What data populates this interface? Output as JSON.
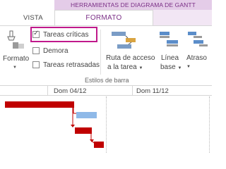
{
  "ribbon": {
    "context_header": "HERRAMIENTAS DE DIAGRAMA DE GANTT",
    "tabs": [
      {
        "label": "VISTA"
      },
      {
        "label": "FORMATO"
      }
    ]
  },
  "format_button": {
    "label": "Formato",
    "icon": "paintbrush-icon"
  },
  "checkboxes": [
    {
      "label": "Tareas críticas",
      "checked": true
    },
    {
      "label": "Demora",
      "checked": false
    },
    {
      "label": "Tareas retrasadas",
      "checked": false
    }
  ],
  "ruta_button": {
    "line1": "Ruta de acceso",
    "line2": "a la tarea",
    "icon": "path-icon"
  },
  "linea_button": {
    "line1": "Línea",
    "line2": "base",
    "icon": "baseline-icon"
  },
  "atraso_button": {
    "line1": "Atraso",
    "icon": "slippage-icon"
  },
  "group_label": "Estilos de barra",
  "timescale": {
    "labels": [
      "Dom 04/12",
      "Dom 11/12"
    ]
  },
  "colors": {
    "accent": "#7a2f86",
    "critical": "#c00000",
    "task": "#8fb9e8",
    "highlight": "#c0198b"
  }
}
